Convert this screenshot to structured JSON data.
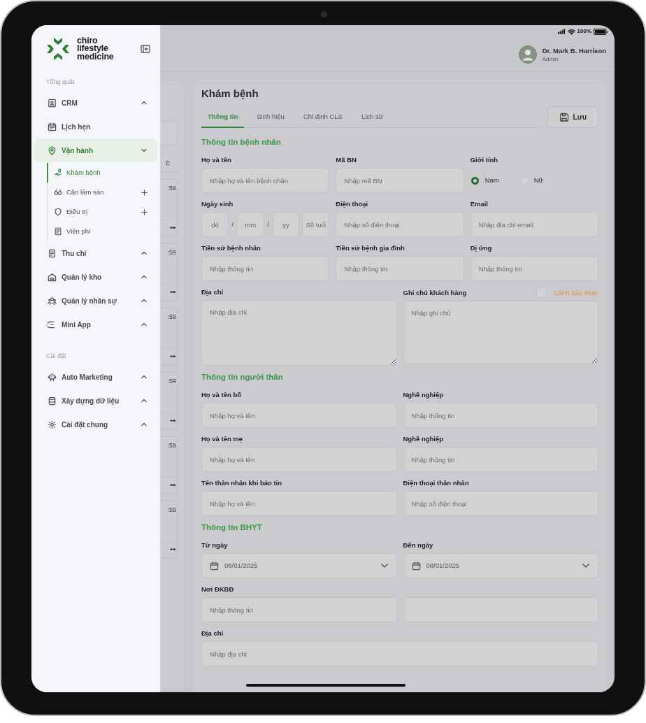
{
  "status_bar": {
    "battery": "100%"
  },
  "sidebar": {
    "logo": [
      "chiro",
      "lifestyle",
      "medicine"
    ],
    "sections": [
      {
        "title": "Tổng quát",
        "items": [
          {
            "label": "CRM",
            "expandable": true,
            "expanded": false,
            "selected": false
          },
          {
            "label": "Lịch hẹn",
            "expandable": false,
            "selected": false
          },
          {
            "label": "Vận hành",
            "expandable": true,
            "expanded": true,
            "selected": true,
            "children": [
              {
                "label": "Khám bệnh",
                "selected": true,
                "expandable": false
              },
              {
                "label": "Cận lâm sàn",
                "selected": false,
                "expandable": true
              },
              {
                "label": "Điều trị",
                "selected": false,
                "expandable": true
              },
              {
                "label": "Viện phí",
                "selected": false,
                "expandable": false
              }
            ]
          },
          {
            "label": "Thu chi",
            "expandable": true,
            "expanded": false,
            "selected": false
          },
          {
            "label": "Quản lý kho",
            "expandable": true,
            "expanded": false,
            "selected": false
          },
          {
            "label": "Quản lý nhân sự",
            "expandable": true,
            "expanded": false,
            "selected": false
          },
          {
            "label": "Mini App",
            "expandable": true,
            "expanded": false,
            "selected": false
          }
        ]
      },
      {
        "title": "Cài đặt",
        "items": [
          {
            "label": "Auto Marketing",
            "expandable": true,
            "expanded": false,
            "selected": false
          },
          {
            "label": "Xây dựng dữ liệu",
            "expandable": true,
            "expanded": false,
            "selected": false
          },
          {
            "label": "Cài đặt chung",
            "expandable": true,
            "expanded": false,
            "selected": false
          }
        ]
      }
    ]
  },
  "user": {
    "name": "Dr. Mark B. Harrison",
    "role": "Admin"
  },
  "list_panel": {
    "column_heading": "E",
    "cards": [
      {
        "time": ":59",
        "more": "•••"
      },
      {
        "time": ":59",
        "more": "•••"
      },
      {
        "time": ":59",
        "more": "•••"
      },
      {
        "time": ":59",
        "more": "•••"
      },
      {
        "time": ":59",
        "more": "•••"
      },
      {
        "time": ":59",
        "more": "•••"
      }
    ]
  },
  "form": {
    "title": "Khám bệnh",
    "tabs": [
      {
        "label": "Thông tin",
        "selected": true
      },
      {
        "label": "Sinh hiệu",
        "selected": false
      },
      {
        "label": "Chỉ định CLS",
        "selected": false
      },
      {
        "label": "Lịch sử",
        "selected": false
      }
    ],
    "save_button": "Lưu",
    "sections": [
      {
        "title": "Thông tin bệnh nhân",
        "rows": [
          [
            {
              "kind": "text",
              "label": "Họ và tên",
              "placeholder": "Nhập họ và tên bệnh nhân"
            },
            {
              "kind": "text",
              "label": "Mã BN",
              "placeholder": "Nhập mã BN"
            },
            {
              "kind": "radio",
              "label": "Giới tính",
              "options": [
                {
                  "label": "Nam",
                  "selected": true
                },
                {
                  "label": "Nữ",
                  "selected": false
                }
              ]
            }
          ],
          [
            {
              "kind": "dob",
              "label": "Ngày sinh",
              "parts": [
                {
                  "placeholder": "dd"
                },
                {
                  "placeholder": "mm"
                },
                {
                  "placeholder": "yy"
                },
                {
                  "placeholder": "Số tuổi"
                }
              ],
              "separator": "/"
            },
            {
              "kind": "text",
              "label": "Điện thoại",
              "placeholder": "Nhập số điện thoại"
            },
            {
              "kind": "text",
              "label": "Email",
              "placeholder": "Nhập địa chỉ email"
            }
          ],
          [
            {
              "kind": "text",
              "label": "Tiền sử bệnh nhân",
              "placeholder": "Nhập thông tin"
            },
            {
              "kind": "text",
              "label": "Tiền sử bệnh gia đình",
              "placeholder": "Nhập thông tin"
            },
            {
              "kind": "text",
              "label": "Dị ứng",
              "placeholder": "Nhập thông tin"
            }
          ]
        ],
        "wide_rows": [
          [
            {
              "kind": "textarea",
              "label": "Địa chỉ",
              "placeholder": "Nhập địa chỉ"
            },
            {
              "kind": "textarea",
              "label": "Ghi chú khách hàng",
              "placeholder": "Nhập ghi chú",
              "flag": {
                "label": "Cảnh báo khác",
                "checked": false
              }
            }
          ]
        ]
      },
      {
        "title": "Thông tin người thân",
        "rows": [
          [
            {
              "kind": "text",
              "label": "Họ và tên bố",
              "placeholder": "Nhập họ và tên"
            },
            {
              "kind": "text",
              "label": "Nghề nghiệp",
              "placeholder": "Nhập thông tin"
            }
          ],
          [
            {
              "kind": "text",
              "label": "Họ và tên mẹ",
              "placeholder": "Nhập họ và tên"
            },
            {
              "kind": "text",
              "label": "Nghề nghiệp",
              "placeholder": "Nhập thông tin"
            }
          ],
          [
            {
              "kind": "text",
              "label": "Tên thân nhân khi báo tin",
              "placeholder": "Nhập họ và tên"
            },
            {
              "kind": "text",
              "label": "Điện thoại thân nhân",
              "placeholder": "Nhập số điện thoại"
            }
          ]
        ]
      },
      {
        "title": "Thông tin BHYT",
        "rows": [
          [
            {
              "kind": "date",
              "label": "Từ ngày",
              "value": "08/01/2025"
            },
            {
              "kind": "date",
              "label": "Đến ngày",
              "value": "08/01/2025"
            }
          ],
          [
            {
              "kind": "text",
              "label": "Nơi ĐKBĐ",
              "placeholder": "Nhập thông tin"
            },
            {
              "kind": "text"
            }
          ],
          [
            {
              "kind": "text",
              "label": "Địa chỉ",
              "placeholder": "Nhập địa chỉ"
            }
          ]
        ]
      }
    ]
  }
}
